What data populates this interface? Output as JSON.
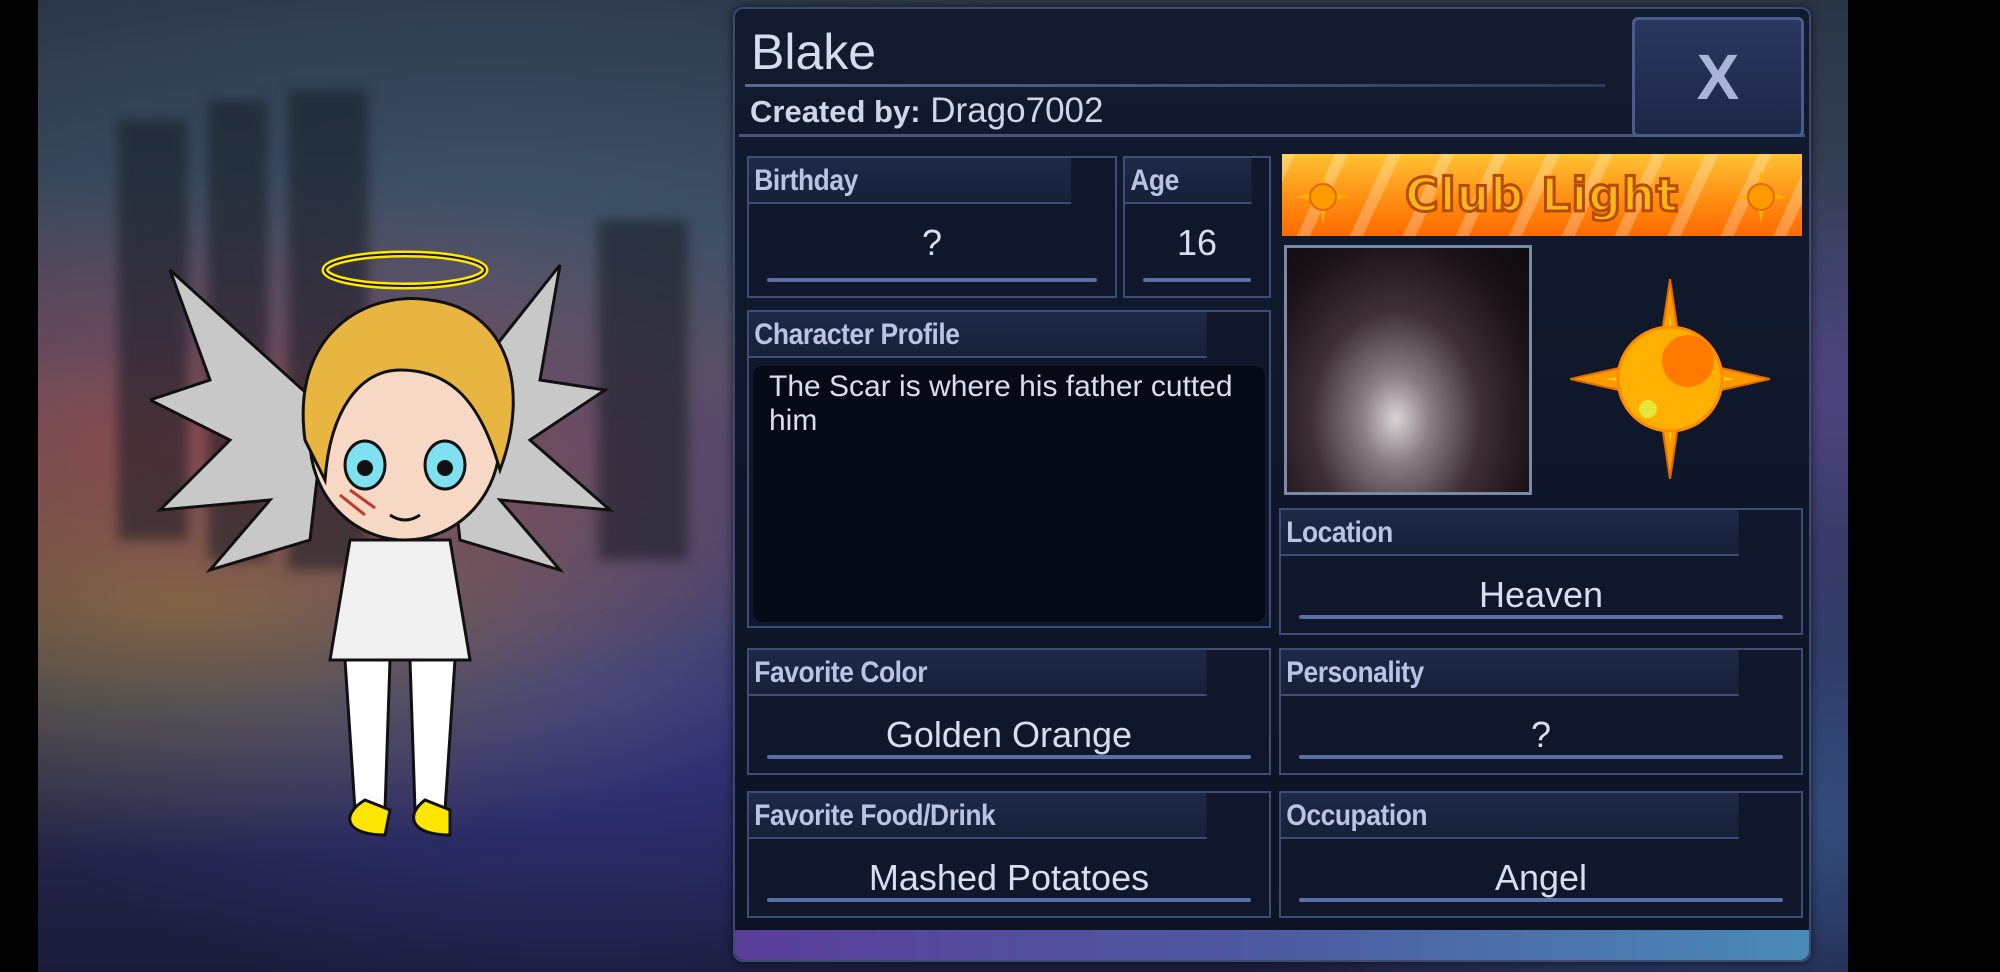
{
  "character": {
    "name": "Blake",
    "created_by_label": "Created by:",
    "creator": "Drago7002"
  },
  "close_button": {
    "label": "X"
  },
  "fields": {
    "birthday": {
      "label": "Birthday",
      "value": "?"
    },
    "age": {
      "label": "Age",
      "value": "16"
    },
    "profile": {
      "label": "Character Profile",
      "value": "The Scar is where his father cutted him"
    },
    "location": {
      "label": "Location",
      "value": "Heaven"
    },
    "favorite_color": {
      "label": "Favorite Color",
      "value": "Golden Orange"
    },
    "personality": {
      "label": "Personality",
      "value": "?"
    },
    "favorite_food": {
      "label": "Favorite Food/Drink",
      "value": "Mashed Potatoes"
    },
    "occupation": {
      "label": "Occupation",
      "value": "Angel"
    }
  },
  "club": {
    "name": "Club Light",
    "icon": "sun-icon"
  },
  "colors": {
    "panel_bg": "#0f1628",
    "panel_border": "#3a4a70",
    "label_text": "#b9c4e2",
    "value_text": "#d8def0",
    "banner_orange": "#ff8a10"
  }
}
